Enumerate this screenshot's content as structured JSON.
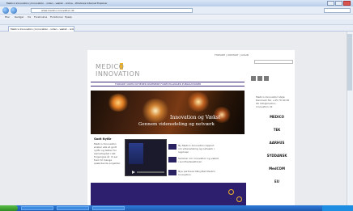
{
  "browser": {
    "window_title": "Medico Innovation | Innovation - viden - vækst - online - Windows Internet Explorer",
    "address": "www.medico-innovation.dk",
    "menu": [
      "Filer",
      "Rediger",
      "Vis",
      "Foretrukne",
      "Funktioner",
      "Hjælp"
    ],
    "tab_label": "Medico Innovation | Innovation - viden - vækst - online"
  },
  "site": {
    "logo_line1": "MEDICO",
    "logo_line2": "INNOVATION",
    "top_links": "FORSIDE  |  KONTAKT  |  LOGIN",
    "nav": "FORSIDE  VIDEN  NYHEDER  PARTNERE  FORESTILLINGER  PUBLIKATIONER",
    "hero_title": "Innovation og Vækst",
    "hero_subtitle": "Gennem vidensdeling og netværk",
    "section_title": "Godt Nytår",
    "section_text": "Medico Innovation ønsker alle et godt nytår og takker for samarbejdet i det forgangne år. Vi ser frem til mange spændende projekter.",
    "news": [
      "Ny Medico Innovation rapport om vidensdeling og netværk i regionen",
      "Seminar om innovation og vækst i sundhedssektoren",
      "Nye partnere tilknyttet Medico Innovation"
    ],
    "side_address": "Medico Innovation Vejle Denmark Tel. +45 70 00 00 00 info@medico-innovation.dk",
    "partners": [
      "MEDICO",
      "TEK",
      "AARHUS",
      "SYDDANSK",
      "MedCOM",
      "EU"
    ]
  },
  "colors": {
    "brand_purple": "#3d2a7a",
    "accent_yellow": "#f0b428",
    "taskbar_blue": "#2e7bd8"
  }
}
